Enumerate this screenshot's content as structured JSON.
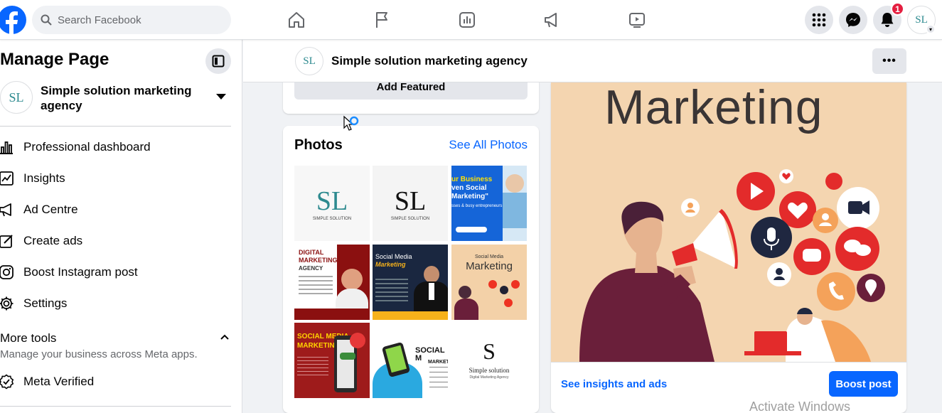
{
  "topbar": {
    "search_placeholder": "Search Facebook",
    "nav_icons": [
      "home-icon",
      "flag-icon",
      "ads-manager-icon",
      "megaphone-icon",
      "video-icon"
    ],
    "notification_count": "1",
    "avatar_initials": "SL"
  },
  "sidebar": {
    "title": "Manage Page",
    "page_name": "Simple solution marketing agency",
    "page_initials": "SL",
    "items": [
      {
        "label": "Professional dashboard",
        "icon": "dashboard-icon"
      },
      {
        "label": "Insights",
        "icon": "insights-icon"
      },
      {
        "label": "Ad Centre",
        "icon": "megaphone-icon"
      },
      {
        "label": "Create ads",
        "icon": "pencil-icon"
      },
      {
        "label": "Boost Instagram post",
        "icon": "instagram-icon"
      },
      {
        "label": "Settings",
        "icon": "gear-icon"
      }
    ],
    "more_tools": {
      "title": "More tools",
      "subtitle": "Manage your business across Meta apps."
    },
    "meta_verified": "Meta Verified"
  },
  "page_header": {
    "name": "Simple solution marketing agency",
    "initials": "SL"
  },
  "featured": {
    "add_label": "Add Featured"
  },
  "photos": {
    "title": "Photos",
    "see_all": "See All Photos",
    "tiles": [
      {
        "text_top": "SL",
        "text_bottom": "SIMPLE SOLUTION"
      },
      {
        "text_top": "SL",
        "text_bottom": "SIMPLE SOLUTION"
      },
      {
        "line1": "ur Business",
        "line2": "ven Social",
        "line3": "Marketing\"",
        "line4": "sses & busy entrepreneurs"
      },
      {
        "line1": "DIGITAL",
        "line2": "MARKETING",
        "line3": "AGENCY"
      },
      {
        "line1": "Social Media",
        "line2": "Marketing"
      },
      {
        "line1": "Social Media",
        "line2": "Marketing"
      },
      {
        "line1": "SOCIAL MEDIA",
        "line2": "MARKETING"
      },
      {
        "line1": "SOCIAL M",
        "line2": "MARKETI"
      },
      {
        "line1": "S",
        "line2": "Simple solution",
        "line3": "Digital Marketing Agency"
      }
    ]
  },
  "post": {
    "heading": "Marketing",
    "insights_link": "See insights and ads",
    "boost_label": "Boost post"
  },
  "system": {
    "watermark": "Activate Windows"
  },
  "colors": {
    "brand_blue": "#0866ff",
    "badge_red": "#e41e3f",
    "post_bg": "#f4d5b0"
  }
}
